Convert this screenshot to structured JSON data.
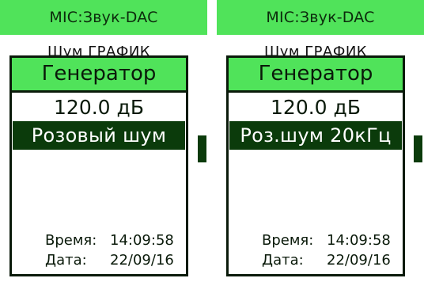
{
  "screens": [
    {
      "header": "MIC:Звук-DAC",
      "subtitle": "Шум ГРАФИК",
      "popup": {
        "title": "Генератор",
        "level": "120.0 дБ",
        "selected": "Розовый шум"
      },
      "time_label": "Время:",
      "time_value": "14:09:58",
      "date_label": "Дата:",
      "date_value": "22/09/16"
    },
    {
      "header": "MIC:Звук-DAC",
      "subtitle": "Шум ГРАФИК",
      "popup": {
        "title": "Генератор",
        "level": "120.0 дБ",
        "selected": "Роз.шум 20кГц"
      },
      "time_label": "Время:",
      "time_value": "14:09:58",
      "date_label": "Дата:",
      "date_value": "22/09/16"
    }
  ],
  "colors": {
    "header_bg": "#50e35a",
    "selected_bg": "#0b3b0b",
    "text": "#0a1a0a"
  }
}
